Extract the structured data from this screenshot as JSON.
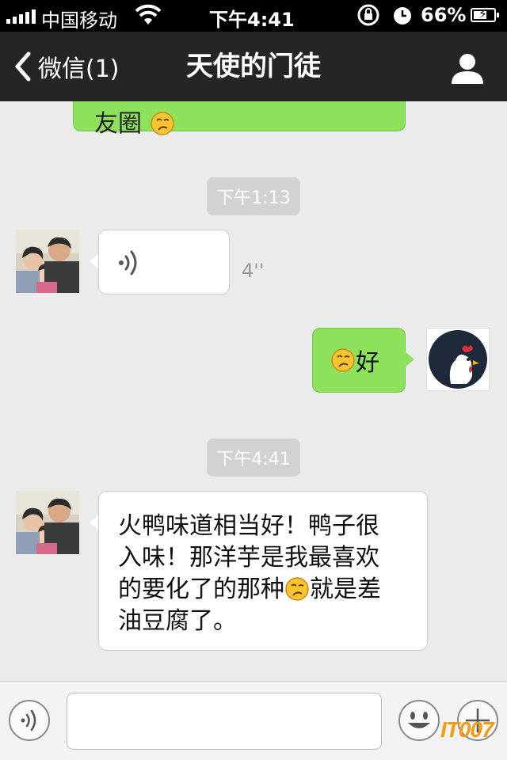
{
  "status_bar": {
    "carrier": "中国移动",
    "time": "下午4:41",
    "battery_percent": "66%",
    "battery_level": 0.66,
    "icons": [
      "signal-icon",
      "wifi-icon",
      "rotation-lock-icon",
      "alarm-icon",
      "battery-icon"
    ]
  },
  "nav": {
    "back_label": "微信(1)",
    "title": "天使的门徒",
    "icons": [
      "chevron-left-icon",
      "profile-icon"
    ]
  },
  "chat": {
    "previous_message_tail": "友圈",
    "timestamps": [
      "下午1:13",
      "下午4:41"
    ],
    "messages": [
      {
        "from": "other",
        "type": "voice",
        "duration": "4''"
      },
      {
        "from": "me",
        "type": "text",
        "text": "好",
        "emoji": "thinking-face-emoji"
      },
      {
        "from": "other",
        "type": "text",
        "lines": [
          "火鸭味道相当好！鸭子很",
          "入味！那洋芋是我最喜欢",
          "的要化了的那种",
          "就是差",
          "油豆腐了。"
        ]
      }
    ]
  },
  "input_bar": {
    "placeholder": "",
    "icons": [
      "voice-toggle-icon",
      "emoji-icon",
      "plus-icon"
    ]
  },
  "watermark": "IT007",
  "colors": {
    "nav_bg": "#252525",
    "chat_bg": "#ebebeb",
    "sent_bubble": "#8ee25b",
    "received_bubble": "#ffffff",
    "timestamp_bg": "#d2d2d2"
  }
}
